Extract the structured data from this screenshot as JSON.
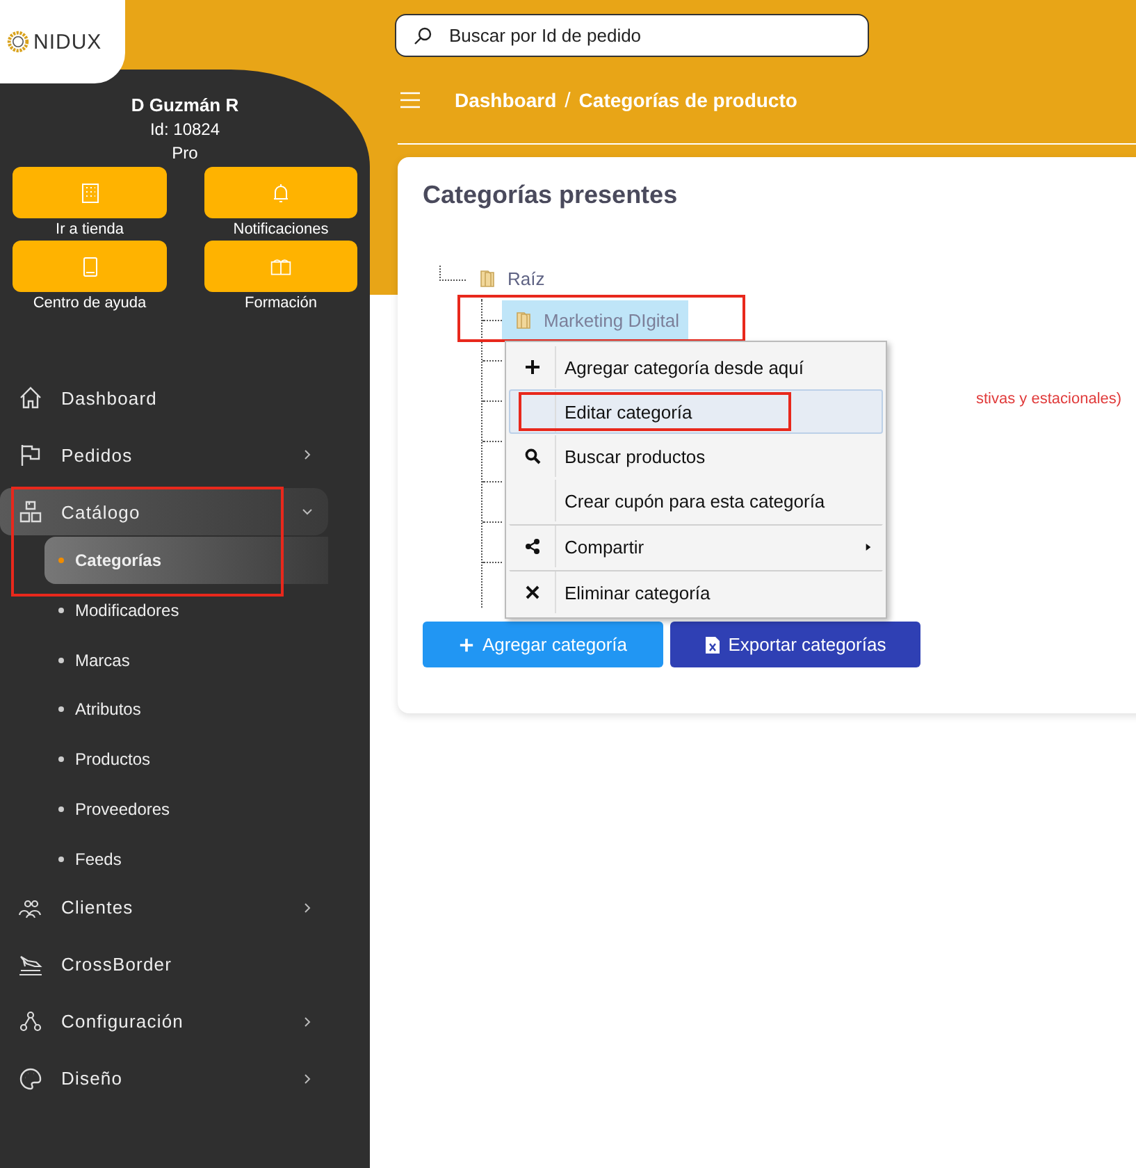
{
  "brand": {
    "name": "NIDUX"
  },
  "user": {
    "name": "D Guzmán R",
    "id": "Id: 10824",
    "plan": "Pro"
  },
  "quick_actions": [
    {
      "label": "Ir a tienda",
      "kind": "store"
    },
    {
      "label": "Notificaciones",
      "kind": "bell"
    },
    {
      "label": "Centro de ayuda",
      "kind": "book"
    },
    {
      "label": "Formación",
      "kind": "open-book"
    }
  ],
  "nav": [
    {
      "label": "Dashboard",
      "kind": "home",
      "submenu": false,
      "expanded": false,
      "selected": false
    },
    {
      "label": "Pedidos",
      "kind": "flag",
      "submenu": true,
      "expanded": false,
      "selected": false
    },
    {
      "label": "Catálogo",
      "kind": "boxes",
      "submenu": true,
      "expanded": true,
      "selected": true,
      "annotated": true,
      "children": [
        {
          "label": "Categorías",
          "selected": true
        },
        {
          "label": "Modificadores",
          "selected": false
        },
        {
          "label": "Marcas",
          "selected": false
        },
        {
          "label": "Atributos",
          "selected": false
        },
        {
          "label": "Productos",
          "selected": false
        },
        {
          "label": "Proveedores",
          "selected": false
        },
        {
          "label": "Feeds",
          "selected": false
        }
      ]
    },
    {
      "label": "Clientes",
      "kind": "people",
      "submenu": true,
      "expanded": false,
      "selected": false
    },
    {
      "label": "CrossBorder",
      "kind": "plane",
      "submenu": false,
      "expanded": false,
      "selected": false
    },
    {
      "label": "Configuración",
      "kind": "nodes",
      "submenu": true,
      "expanded": false,
      "selected": false
    },
    {
      "label": "Diseño",
      "kind": "palette",
      "submenu": true,
      "expanded": false,
      "selected": false
    }
  ],
  "search": {
    "placeholder": "Buscar por Id de pedido"
  },
  "breadcrumb": {
    "items": [
      "Dashboard",
      "Categorías de producto"
    ],
    "separator": "/"
  },
  "card": {
    "title": "Categorías presentes",
    "tree": {
      "label": "Raíz",
      "children": [
        {
          "label": "Marketing DIgital",
          "selected": true,
          "annotated": true
        }
      ]
    },
    "covered_note": "stivas y estacionales)",
    "context_menu": [
      {
        "label": "Agregar categoría desde aquí",
        "kind": "plus",
        "separator_before": false,
        "submenu": false,
        "selected": false
      },
      {
        "label": "Editar categoría",
        "kind": "plain",
        "separator_before": false,
        "submenu": false,
        "selected": true,
        "annotated": true
      },
      {
        "label": "Buscar productos",
        "kind": "search",
        "separator_before": false,
        "submenu": false,
        "selected": false
      },
      {
        "label": "Crear cupón para esta categoría",
        "kind": "plain",
        "separator_before": false,
        "submenu": false,
        "selected": false
      },
      {
        "label": "Compartir",
        "kind": "share",
        "separator_before": true,
        "submenu": true,
        "selected": false
      },
      {
        "label": "Eliminar categoría",
        "kind": "cross",
        "separator_before": true,
        "submenu": false,
        "selected": false
      }
    ],
    "buttons": [
      {
        "label": "Agregar categoría",
        "kind": "add"
      },
      {
        "label": "Exportar categorías",
        "kind": "export"
      }
    ]
  }
}
